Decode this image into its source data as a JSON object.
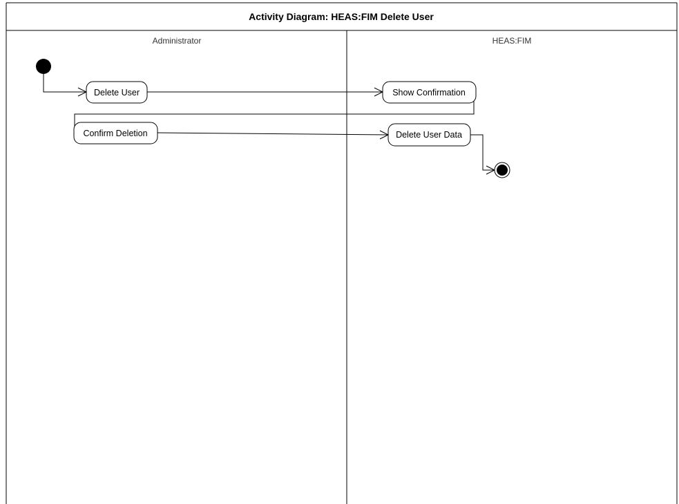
{
  "diagram": {
    "title": "Activity Diagram: HEAS:FIM Delete User",
    "lanes": [
      {
        "label": "Administrator"
      },
      {
        "label": "HEAS:FIM"
      }
    ],
    "activities": [
      {
        "id": "delete-user",
        "label": "Delete User"
      },
      {
        "id": "show-confirmation",
        "label": "Show Confirmation"
      },
      {
        "id": "confirm-deletion",
        "label": "Confirm Deletion"
      },
      {
        "id": "delete-user-data",
        "label": "Delete User Data"
      }
    ],
    "flows": [
      {
        "from": "initial",
        "to": "delete-user"
      },
      {
        "from": "delete-user",
        "to": "show-confirmation"
      },
      {
        "from": "show-confirmation",
        "to": "confirm-deletion"
      },
      {
        "from": "confirm-deletion",
        "to": "delete-user-data"
      },
      {
        "from": "delete-user-data",
        "to": "final"
      }
    ]
  }
}
